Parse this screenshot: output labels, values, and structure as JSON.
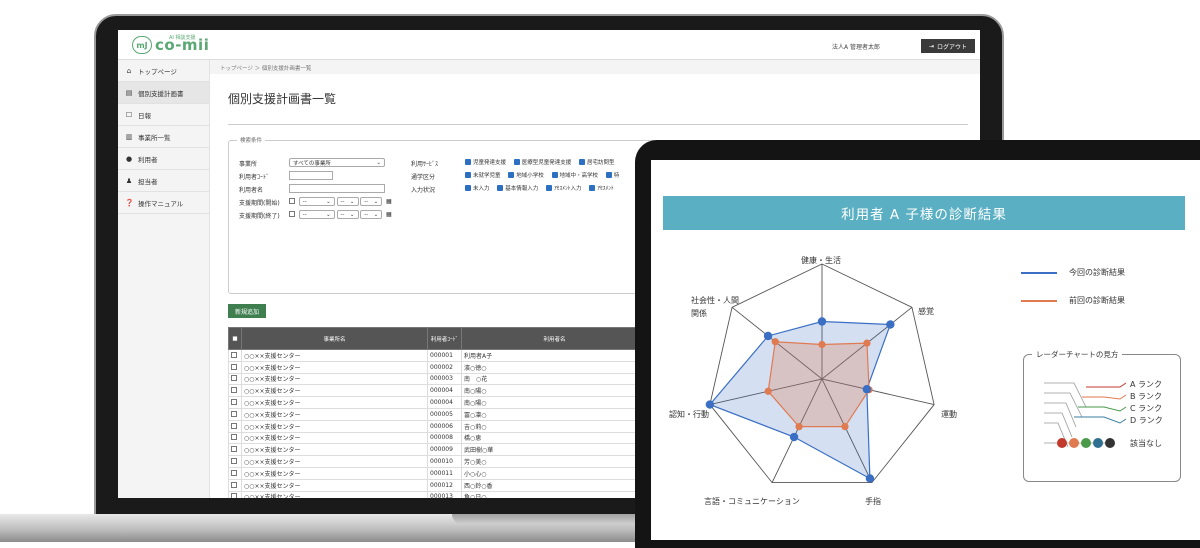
{
  "app": {
    "logo_mark": "mJ",
    "logo_text": "co-mii",
    "logo_sub": "AI 相談支援",
    "user": "法人A 管理者太郎",
    "logout": "ログアウト"
  },
  "sidebar": {
    "items": [
      {
        "icon": "home-icon",
        "glyph": "⌂",
        "label": "トップページ"
      },
      {
        "icon": "document-icon",
        "glyph": "▤",
        "label": "個別支援計画書"
      },
      {
        "icon": "calendar-icon",
        "glyph": "☐",
        "label": "日報"
      },
      {
        "icon": "building-icon",
        "glyph": "▥",
        "label": "事業所一覧"
      },
      {
        "icon": "user-icon",
        "glyph": "●",
        "label": "利用者"
      },
      {
        "icon": "staff-icon",
        "glyph": "♟",
        "label": "担当者"
      },
      {
        "icon": "help-icon",
        "glyph": "❓",
        "label": "操作マニュアル"
      }
    ]
  },
  "breadcrumb": "トップページ ＞ 個別支援計画書一覧",
  "page_title": "個別支援計画書一覧",
  "search": {
    "legend": "検索条件",
    "office_label": "事業所",
    "office_value": "すべての事業所",
    "user_code_label": "利用者ｺｰﾄﾞ",
    "user_name_label": "利用者名",
    "period_start_label": "支援期間(開始)",
    "period_end_label": "支援期間(終了)",
    "date_placeholder": "--",
    "service_label": "利用ｻｰﾋﾞｽ",
    "service_options": [
      "児童発達支援",
      "医療型児童発達支援",
      "居宅訪問型"
    ],
    "school_label": "通学区分",
    "school_options": [
      "未就学児童",
      "地域小学校",
      "地域中・高学校",
      "特"
    ],
    "input_label": "入力状況",
    "input_options": [
      "未入力",
      "基本情報入力",
      "ｱｾｽﾒﾝﾄ入力",
      "ｱｾｽﾒﾝﾄ"
    ]
  },
  "add_button": "新規追加",
  "table": {
    "headers": [
      "",
      "事業所名",
      "利用者ｺｰﾄﾞ",
      "利用者名"
    ],
    "rows": [
      [
        "○○××支援センター",
        "000001",
        "利用者A子"
      ],
      [
        "○○××支援センター",
        "000002",
        "濱○徳○"
      ],
      [
        "○○××支援センター",
        "000003",
        "南　○花"
      ],
      [
        "○○××支援センター",
        "000004",
        "南○陽○"
      ],
      [
        "○○××支援センター",
        "000004",
        "南○陽○"
      ],
      [
        "○○××支援センター",
        "000005",
        "冨○凜○"
      ],
      [
        "○○××支援センター",
        "000006",
        "吉○莉○"
      ],
      [
        "○○××支援センター",
        "000008",
        "橋○恵"
      ],
      [
        "○○××支援センター",
        "000009",
        "武田樹○華"
      ],
      [
        "○○××支援センター",
        "000010",
        "芳○美○"
      ],
      [
        "○○××支援センター",
        "000011",
        "小○心○"
      ],
      [
        "○○××支援センター",
        "000012",
        "西○鈴○香"
      ],
      [
        "○○××支援センター",
        "000013",
        "魚○日○"
      ]
    ]
  },
  "result": {
    "title": "利用者 A 子様の診断結果",
    "axes": [
      "健康・生活",
      "感覚",
      "運動",
      "手指",
      "言語・コミュニケーション",
      "認知・行動",
      "社会性・人間関係"
    ],
    "legend_current": "今回の診断結果",
    "legend_previous": "前回の診断結果",
    "howto_title": "レーダーチャートの見方",
    "ranks": [
      "A ランク",
      "B ランク",
      "C ランク",
      "D ランク",
      "該当なし"
    ],
    "colors": {
      "current": "#3a6fc4",
      "previous": "#e07a50",
      "header": "#5aafc3"
    }
  },
  "chart_data": {
    "type": "radar",
    "title": "利用者 A 子様の診断結果",
    "categories": [
      "健康・生活",
      "感覚",
      "運動",
      "手指",
      "言語・コミュニケーション",
      "認知・行動",
      "社会性・人間関係"
    ],
    "levels": [
      "該当なし",
      "D ランク",
      "C ランク",
      "B ランク",
      "A ランク"
    ],
    "series": [
      {
        "name": "今回の診断結果",
        "values": [
          2.5,
          3.8,
          2.0,
          4.8,
          2.8,
          5.0,
          3.0
        ]
      },
      {
        "name": "前回の診断結果",
        "values": [
          1.5,
          2.5,
          2.1,
          2.3,
          2.3,
          2.4,
          2.6
        ]
      }
    ]
  }
}
